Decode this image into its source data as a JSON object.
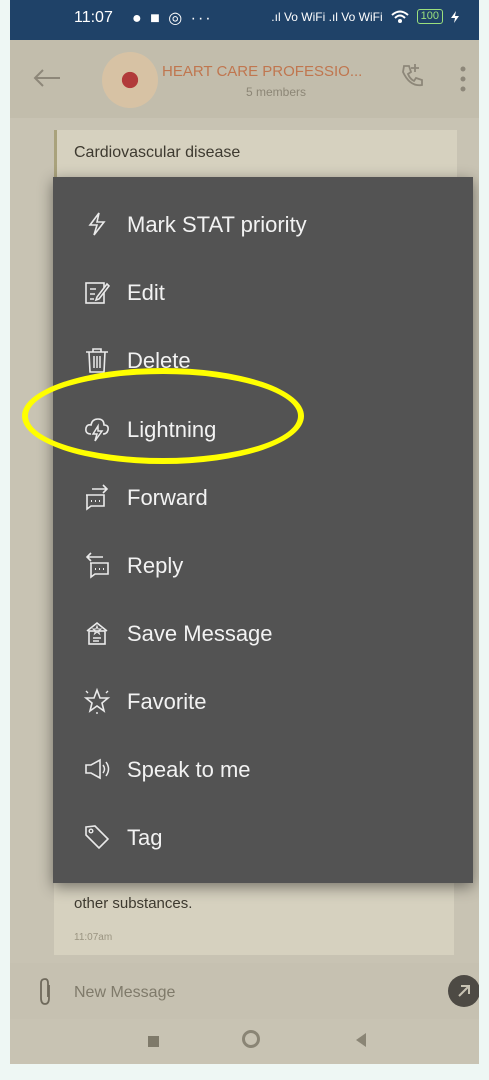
{
  "status_bar": {
    "time": "11:07",
    "indicators": "● ■ ◎  ···",
    "signal_text": ".ıl Vo WiFi .ıl Vo WiFi",
    "battery": "100"
  },
  "header": {
    "group_name": "HEART CARE PROFESSIO...",
    "members": "5 members",
    "icons": [
      "back-arrow-icon",
      "group-avatar",
      "call-icon",
      "more-icon"
    ]
  },
  "chat": {
    "top_message": "Cardiovascular disease",
    "bottom_message": "other substances.",
    "bottom_time": "11:07am"
  },
  "context_menu": {
    "items": [
      {
        "label": "Mark STAT priority",
        "icon": "lightning-bolt-icon"
      },
      {
        "label": "Edit",
        "icon": "edit-icon"
      },
      {
        "label": "Delete",
        "icon": "trash-icon"
      },
      {
        "label": "Lightning",
        "icon": "cloud-lightning-icon"
      },
      {
        "label": "Forward",
        "icon": "forward-icon"
      },
      {
        "label": "Reply",
        "icon": "reply-icon"
      },
      {
        "label": "Save Message",
        "icon": "save-message-icon"
      },
      {
        "label": "Favorite",
        "icon": "star-icon"
      },
      {
        "label": "Speak to me",
        "icon": "speaker-icon"
      },
      {
        "label": "Tag",
        "icon": "tag-icon"
      }
    ],
    "highlighted": "Lightning",
    "highlight_color": "#ffff00"
  },
  "composer": {
    "placeholder": "New Message"
  },
  "colors": {
    "status_bar": "#1f4268",
    "menu_bg": "#535353",
    "dim_bg": "#c8c3b3"
  }
}
